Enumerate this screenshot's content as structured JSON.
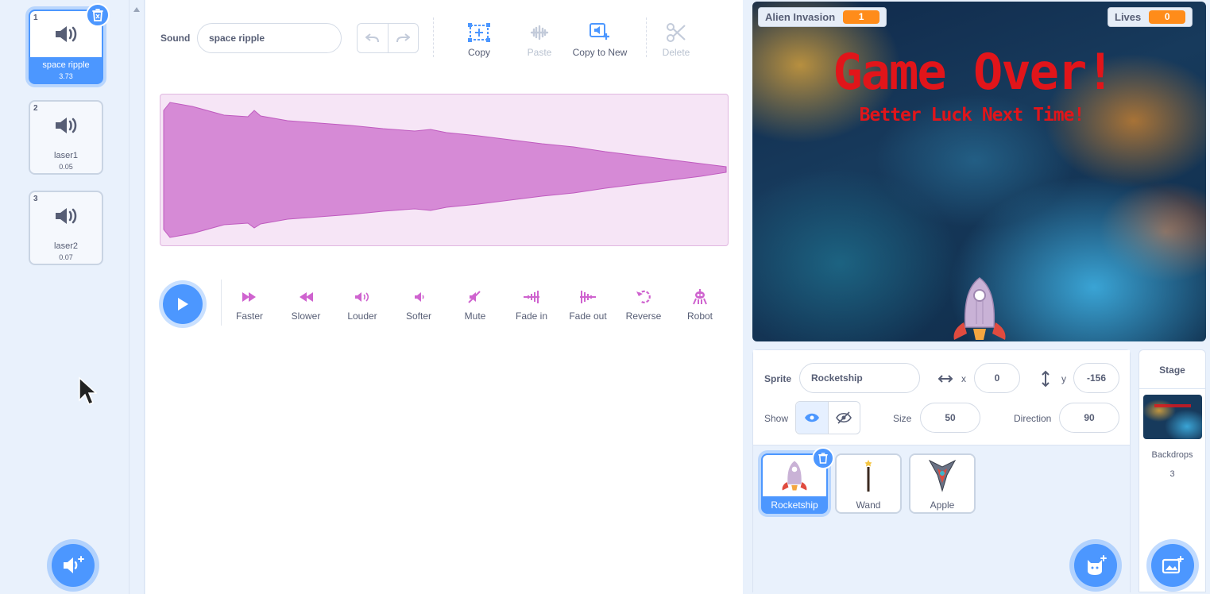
{
  "sounds": [
    {
      "index": "1",
      "name": "space ripple",
      "duration": "3.73",
      "selected": true
    },
    {
      "index": "2",
      "name": "laser1",
      "duration": "0.05",
      "selected": false
    },
    {
      "index": "3",
      "name": "laser2",
      "duration": "0.07",
      "selected": false
    }
  ],
  "editor": {
    "sound_label": "Sound",
    "sound_name": "space ripple",
    "tools": {
      "copy": "Copy",
      "paste": "Paste",
      "copy_to_new": "Copy to New",
      "delete": "Delete"
    },
    "effects": {
      "faster": "Faster",
      "slower": "Slower",
      "louder": "Louder",
      "softer": "Softer",
      "mute": "Mute",
      "fade_in": "Fade in",
      "fade_out": "Fade out",
      "reverse": "Reverse",
      "robot": "Robot"
    },
    "waveform_color": "#d68ad6"
  },
  "stage": {
    "monitors": [
      {
        "label": "Alien Invasion",
        "value": "1"
      },
      {
        "label": "Lives",
        "value": "0"
      }
    ],
    "title": "Game Over!",
    "subtitle": "Better Luck Next Time!"
  },
  "sprite_info": {
    "sprite_label": "Sprite",
    "sprite_name": "Rocketship",
    "x_label": "x",
    "x": "0",
    "y_label": "y",
    "y": "-156",
    "show_label": "Show",
    "size_label": "Size",
    "size": "50",
    "direction_label": "Direction",
    "direction": "90"
  },
  "sprites": [
    {
      "name": "Rocketship",
      "selected": true
    },
    {
      "name": "Wand",
      "selected": false
    },
    {
      "name": "Apple",
      "selected": false
    }
  ],
  "stage_panel": {
    "title": "Stage",
    "backdrops_label": "Backdrops",
    "backdrops_count": "3"
  },
  "colors": {
    "accent": "#4c97ff",
    "sound_purple": "#cf63cf",
    "monitor_orange": "#ff8c1a",
    "game_over_red": "#e1151a"
  }
}
